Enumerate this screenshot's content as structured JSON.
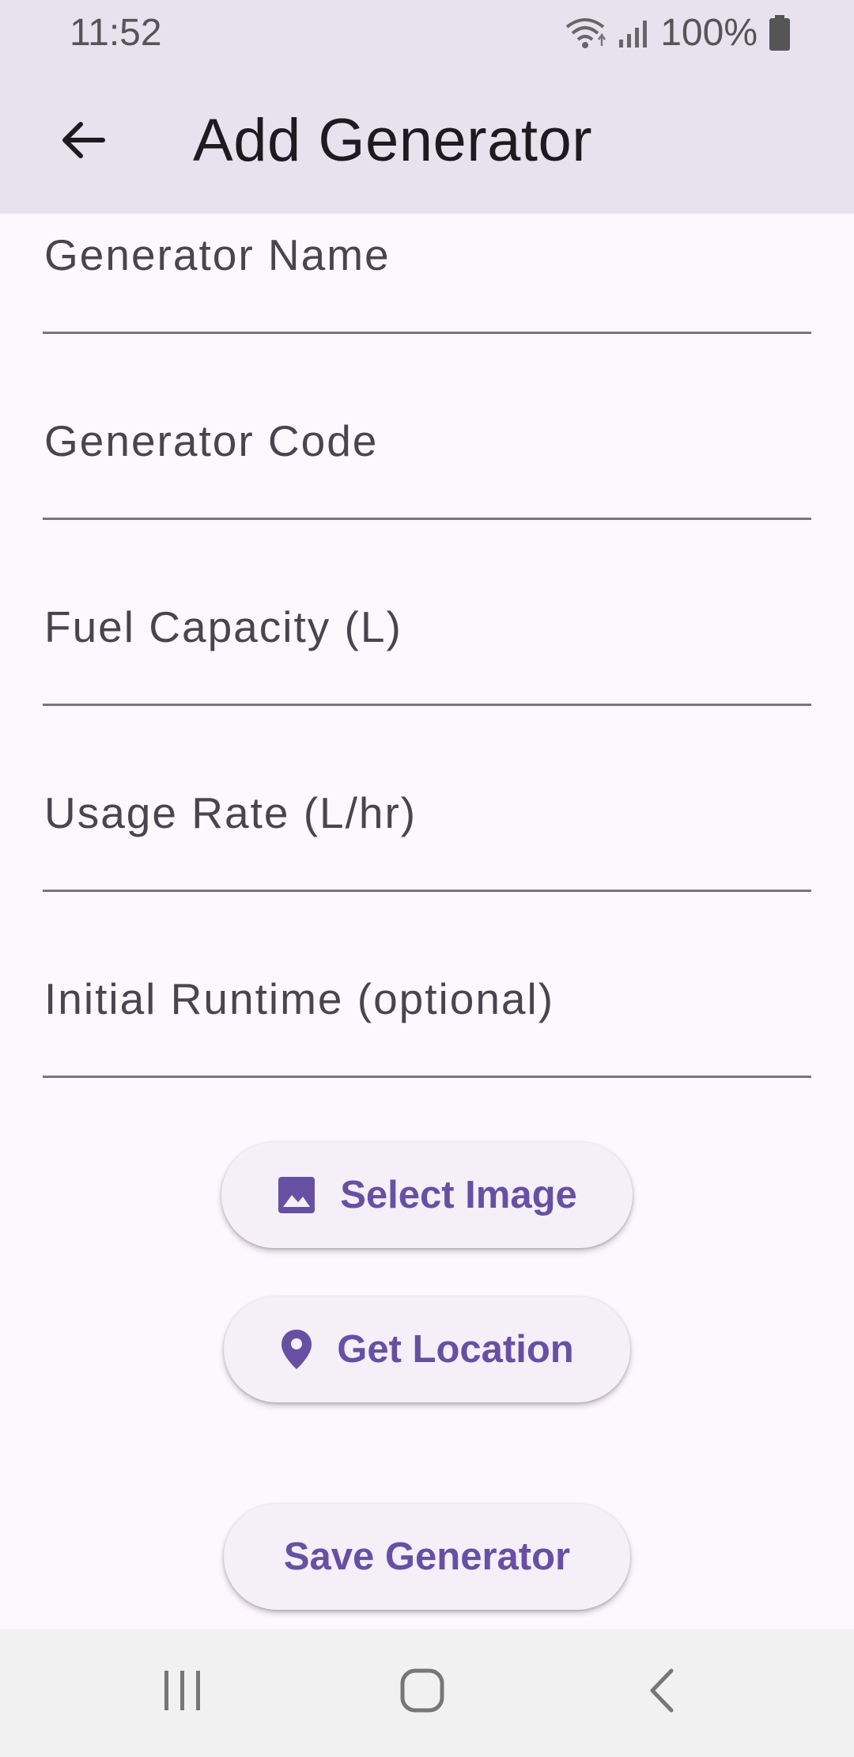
{
  "status_bar": {
    "time": "11:52",
    "battery": "100%",
    "icons": [
      "wifi-icon",
      "signal-icon",
      "battery-icon"
    ]
  },
  "app_bar": {
    "title": "Add Generator",
    "back_icon": "arrow-back-icon"
  },
  "form": {
    "fields": [
      {
        "label": "Generator Name",
        "value": ""
      },
      {
        "label": "Generator Code",
        "value": ""
      },
      {
        "label": "Fuel Capacity (L)",
        "value": ""
      },
      {
        "label": "Usage Rate (L/hr)",
        "value": ""
      },
      {
        "label": "Initial Runtime (optional)",
        "value": ""
      }
    ]
  },
  "buttons": {
    "select_image": {
      "label": "Select Image",
      "icon": "image-icon"
    },
    "get_location": {
      "label": "Get Location",
      "icon": "location-pin-icon"
    },
    "save": {
      "label": "Save Generator"
    }
  },
  "nav_bar": {
    "icons": [
      "recent-apps-icon",
      "home-icon",
      "back-icon"
    ]
  },
  "colors": {
    "accent": "#6750a4",
    "app_bar": "#e8e2ef",
    "background": "#fdf7fe",
    "button_bg": "#f5eff7"
  }
}
